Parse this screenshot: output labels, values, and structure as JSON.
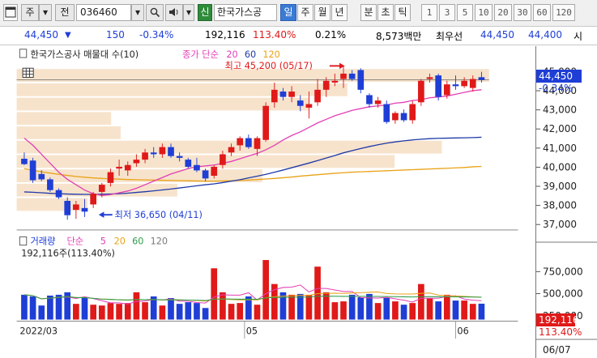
{
  "toolbar": {
    "menu_icon": "window-menu-icon",
    "type_label": "주",
    "dropdown_icon": "chevron-down-icon",
    "jeon_label": "전",
    "code_value": "036460",
    "search_icon": "search-icon",
    "sound_icon": "speaker-icon",
    "new_label": "신",
    "stock_name": "한국가스공",
    "periods": [
      "일",
      "주",
      "월",
      "년",
      "분",
      "초",
      "틱"
    ],
    "active_period": "일",
    "intervals": [
      "1",
      "3",
      "5",
      "10",
      "20",
      "30",
      "60",
      "120"
    ]
  },
  "quote": {
    "price": "44,450",
    "direction_icon": "down-triangle-icon",
    "change": "150",
    "change_pct": "-0.34%",
    "volume": "192,116",
    "volume_ratio": "113.40%",
    "turnover": "0.21%",
    "amount": "8,573백만",
    "priority_label": "최우선",
    "ask": "44,450",
    "bid": "44,400",
    "cut_label": "시"
  },
  "price_pane": {
    "legend_title": "한국가스공사 매물대 수(10)",
    "legend_ma_label": "종가 단순",
    "legend_ma_periods": [
      "20",
      "60",
      "120"
    ],
    "high_annotation": "최고 45,200 (05/17)",
    "low_annotation": "최저 36,650 (04/11)",
    "last_price_tag": "44,450",
    "last_change_tag": "-0.34%",
    "y_ticks": [
      "45,000",
      "44,000",
      "43,000",
      "42,000",
      "41,000",
      "40,000",
      "39,000",
      "38,000",
      "37,000"
    ]
  },
  "volume_pane": {
    "legend_title": "거래량",
    "legend_ma_label": "단순",
    "legend_ma_periods": [
      "5",
      "20",
      "60",
      "120"
    ],
    "summary": "192,116주(113.40%)",
    "y_ticks": [
      "750,000",
      "500,000",
      "250,000"
    ],
    "last_volume_tag": "192,116",
    "last_ratio_tag": "113.40%"
  },
  "x_axis": {
    "labels": [
      "2022/03",
      "05",
      "06"
    ],
    "right_date": "06/07"
  },
  "colors": {
    "up": "#e01919",
    "down": "#1f3ed6",
    "ma20": "#e33fb6",
    "ma60": "#1f3aa8",
    "ma120": "#e8a317",
    "vol_ma5": "#e33fb6",
    "vol_ma20": "#e8a317",
    "vol_ma60": "#2e9b4a",
    "vol_ma120": "#7a7a7a",
    "profile": "#f7e3cc"
  },
  "chart_data": {
    "type": "candlestick",
    "x_range": [
      "2022/03",
      "06/07"
    ],
    "ylim": [
      36500,
      45400
    ],
    "candles": [
      {
        "o": 40050,
        "h": 40400,
        "l": 39700,
        "c": 39750
      },
      {
        "o": 39950,
        "h": 40100,
        "l": 38700,
        "c": 38850
      },
      {
        "o": 39200,
        "h": 39400,
        "l": 38800,
        "c": 38900
      },
      {
        "o": 38900,
        "h": 39000,
        "l": 38200,
        "c": 38300
      },
      {
        "o": 38300,
        "h": 38400,
        "l": 37800,
        "c": 37900
      },
      {
        "o": 37700,
        "h": 37900,
        "l": 36650,
        "c": 36900
      },
      {
        "o": 37200,
        "h": 37700,
        "l": 36700,
        "c": 37500
      },
      {
        "o": 37300,
        "h": 37800,
        "l": 36800,
        "c": 37100
      },
      {
        "o": 37500,
        "h": 38200,
        "l": 37300,
        "c": 38100
      },
      {
        "o": 38200,
        "h": 38700,
        "l": 37900,
        "c": 38600
      },
      {
        "o": 38700,
        "h": 39500,
        "l": 38500,
        "c": 39300
      },
      {
        "o": 39500,
        "h": 40000,
        "l": 39100,
        "c": 39600
      },
      {
        "o": 39400,
        "h": 39900,
        "l": 39100,
        "c": 39700
      },
      {
        "o": 39800,
        "h": 40300,
        "l": 39600,
        "c": 40000
      },
      {
        "o": 40000,
        "h": 40600,
        "l": 39800,
        "c": 40400
      },
      {
        "o": 40400,
        "h": 40700,
        "l": 40100,
        "c": 40300
      },
      {
        "o": 40300,
        "h": 40900,
        "l": 40100,
        "c": 40700
      },
      {
        "o": 40700,
        "h": 40900,
        "l": 40100,
        "c": 40200
      },
      {
        "o": 40200,
        "h": 40400,
        "l": 39900,
        "c": 40100
      },
      {
        "o": 40000,
        "h": 40100,
        "l": 39500,
        "c": 39600
      },
      {
        "o": 39700,
        "h": 40100,
        "l": 39300,
        "c": 39400
      },
      {
        "o": 39400,
        "h": 39500,
        "l": 38800,
        "c": 38950
      },
      {
        "o": 39100,
        "h": 39700,
        "l": 38950,
        "c": 39600
      },
      {
        "o": 39700,
        "h": 40500,
        "l": 39500,
        "c": 40300
      },
      {
        "o": 40400,
        "h": 40900,
        "l": 40200,
        "c": 40700
      },
      {
        "o": 40800,
        "h": 41300,
        "l": 40500,
        "c": 41200
      },
      {
        "o": 41200,
        "h": 41400,
        "l": 40600,
        "c": 40700
      },
      {
        "o": 40600,
        "h": 41300,
        "l": 40200,
        "c": 41200
      },
      {
        "o": 41100,
        "h": 43200,
        "l": 41000,
        "c": 43000
      },
      {
        "o": 43200,
        "h": 44300,
        "l": 42900,
        "c": 43900
      },
      {
        "o": 43800,
        "h": 44000,
        "l": 43300,
        "c": 43500
      },
      {
        "o": 43500,
        "h": 44100,
        "l": 43200,
        "c": 43800
      },
      {
        "o": 43300,
        "h": 43600,
        "l": 42700,
        "c": 43000
      },
      {
        "o": 42900,
        "h": 43800,
        "l": 42300,
        "c": 43100
      },
      {
        "o": 43200,
        "h": 44500,
        "l": 43000,
        "c": 43900
      },
      {
        "o": 43900,
        "h": 44600,
        "l": 43500,
        "c": 44400
      },
      {
        "o": 44300,
        "h": 44800,
        "l": 44100,
        "c": 44400
      },
      {
        "o": 44500,
        "h": 45200,
        "l": 44000,
        "c": 44800
      },
      {
        "o": 44800,
        "h": 45000,
        "l": 44400,
        "c": 44500
      },
      {
        "o": 45000,
        "h": 45100,
        "l": 43700,
        "c": 43900
      },
      {
        "o": 43600,
        "h": 43700,
        "l": 42900,
        "c": 43100
      },
      {
        "o": 43100,
        "h": 43500,
        "l": 42900,
        "c": 43300
      },
      {
        "o": 43100,
        "h": 43300,
        "l": 42000,
        "c": 42100
      },
      {
        "o": 42200,
        "h": 42700,
        "l": 42000,
        "c": 42600
      },
      {
        "o": 42600,
        "h": 42800,
        "l": 42100,
        "c": 42200
      },
      {
        "o": 42200,
        "h": 43300,
        "l": 42000,
        "c": 43100
      },
      {
        "o": 43200,
        "h": 44500,
        "l": 43000,
        "c": 44400
      },
      {
        "o": 44500,
        "h": 44800,
        "l": 44300,
        "c": 44600
      },
      {
        "o": 44700,
        "h": 44800,
        "l": 43300,
        "c": 43500
      },
      {
        "o": 43600,
        "h": 44400,
        "l": 43400,
        "c": 44200
      },
      {
        "o": 44200,
        "h": 44700,
        "l": 43900,
        "c": 44100
      },
      {
        "o": 44100,
        "h": 44600,
        "l": 44000,
        "c": 44400
      },
      {
        "o": 44000,
        "h": 44700,
        "l": 43800,
        "c": 44500
      },
      {
        "o": 44600,
        "h": 44900,
        "l": 44300,
        "c": 44450
      }
    ],
    "ma20": [
      41200,
      40800,
      40300,
      39800,
      39300,
      38900,
      38600,
      38300,
      38100,
      38000,
      38050,
      38150,
      38250,
      38400,
      38600,
      38800,
      39000,
      39200,
      39350,
      39500,
      39600,
      39650,
      39700,
      39800,
      39900,
      40050,
      40200,
      40350,
      40550,
      40800,
      41100,
      41350,
      41550,
      41800,
      42050,
      42250,
      42450,
      42600,
      42750,
      42850,
      42950,
      43000,
      43050,
      43150,
      43200,
      43300,
      43350,
      43450,
      43500,
      43550,
      43650,
      43750,
      43850,
      43900
    ],
    "ma60": [
      38200,
      38180,
      38150,
      38120,
      38100,
      38080,
      38070,
      38060,
      38060,
      38070,
      38080,
      38100,
      38130,
      38170,
      38210,
      38260,
      38310,
      38360,
      38420,
      38480,
      38540,
      38600,
      38650,
      38720,
      38800,
      38880,
      38980,
      39080,
      39180,
      39300,
      39420,
      39550,
      39680,
      39810,
      39950,
      40090,
      40230,
      40380,
      40500,
      40620,
      40730,
      40830,
      40920,
      40990,
      41050,
      41100,
      41140,
      41170,
      41190,
      41200,
      41210,
      41220,
      41230,
      41250
    ],
    "ma120": [
      39500,
      39400,
      39320,
      39250,
      39180,
      39120,
      39060,
      39020,
      38980,
      38950,
      38930,
      38910,
      38890,
      38880,
      38870,
      38860,
      38850,
      38840,
      38830,
      38820,
      38810,
      38800,
      38800,
      38810,
      38820,
      38840,
      38860,
      38890,
      38920,
      38950,
      38990,
      39030,
      39080,
      39120,
      39160,
      39200,
      39240,
      39270,
      39300,
      39320,
      39340,
      39360,
      39380,
      39400,
      39420,
      39440,
      39460,
      39480,
      39500,
      39520,
      39540,
      39560,
      39600,
      39620
    ],
    "volume_profile": [
      {
        "price_from": 44300,
        "price_to": 45100,
        "volume": 100
      },
      {
        "price_from": 43500,
        "price_to": 44300,
        "volume": 70
      },
      {
        "price_from": 42700,
        "price_to": 43500,
        "volume": 62
      },
      {
        "price_from": 41900,
        "price_to": 42700,
        "volume": 20
      },
      {
        "price_from": 41100,
        "price_to": 41900,
        "volume": 22
      },
      {
        "price_from": 40300,
        "price_to": 41100,
        "volume": 90
      },
      {
        "price_from": 39500,
        "price_to": 40300,
        "volume": 80
      },
      {
        "price_from": 38700,
        "price_to": 39500,
        "volume": 52
      },
      {
        "price_from": 37900,
        "price_to": 38700,
        "volume": 34
      },
      {
        "price_from": 37100,
        "price_to": 37900,
        "volume": 15
      }
    ],
    "volume": [
      300000,
      280000,
      170000,
      290000,
      300000,
      330000,
      190000,
      270000,
      180000,
      170000,
      200000,
      190000,
      200000,
      330000,
      210000,
      280000,
      170000,
      260000,
      190000,
      210000,
      200000,
      140000,
      620000,
      330000,
      190000,
      200000,
      280000,
      180000,
      720000,
      430000,
      330000,
      300000,
      310000,
      300000,
      640000,
      330000,
      210000,
      220000,
      300000,
      270000,
      310000,
      200000,
      260000,
      220000,
      180000,
      200000,
      430000,
      260000,
      220000,
      300000,
      230000,
      230000,
      190000,
      192116
    ],
    "volume_ylim": [
      0,
      900000
    ]
  }
}
